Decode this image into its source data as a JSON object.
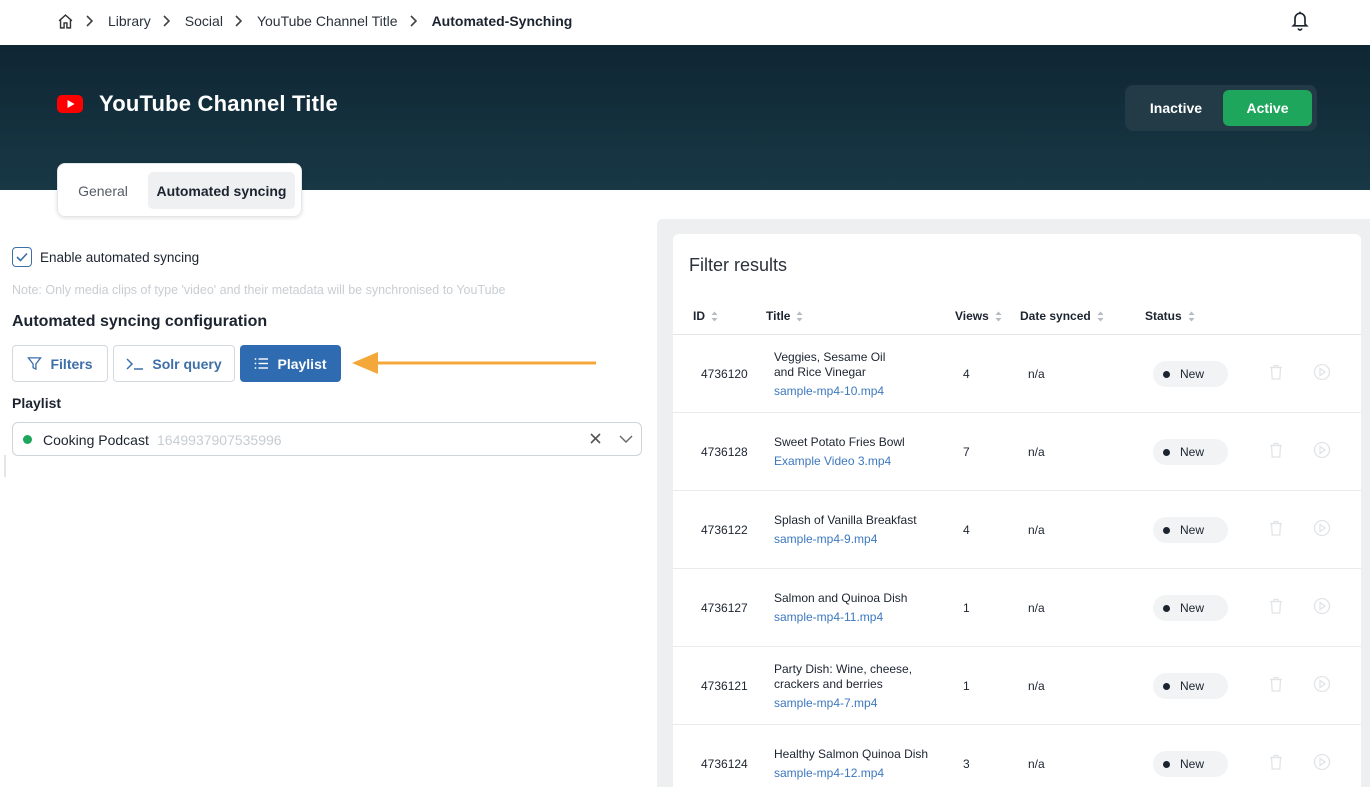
{
  "breadcrumb": {
    "items": [
      "Library",
      "Social",
      "YouTube Channel Title"
    ],
    "current": "Automated-Synching"
  },
  "header": {
    "title": "YouTube Channel Title",
    "status_toggle": {
      "inactive_label": "Inactive",
      "active_label": "Active",
      "selected": "Active"
    }
  },
  "tabs": [
    {
      "label": "General"
    },
    {
      "label": "Automated syncing",
      "selected": true
    }
  ],
  "config": {
    "enable_label": "Enable automated syncing",
    "enabled": true,
    "note": "Note: Only media clips of type 'video' and their metadata will be synchronised to YouTube",
    "section_title": "Automated syncing configuration",
    "buttons": {
      "filters": "Filters",
      "solr": "Solr query",
      "playlist": "Playlist"
    },
    "playlist_label": "Playlist",
    "playlist_name": "Cooking Podcast",
    "playlist_id": "1649937907535996"
  },
  "results": {
    "title": "Filter results",
    "columns": {
      "id": "ID",
      "title": "Title",
      "views": "Views",
      "date": "Date synced",
      "status": "Status"
    },
    "rows": [
      {
        "id": "4736120",
        "title_lines": [
          "Veggies, Sesame Oil",
          "and Rice Vinegar"
        ],
        "file": "sample-mp4-10.mp4",
        "views": "4",
        "date": "n/a",
        "status": "New"
      },
      {
        "id": "4736128",
        "title_lines": [
          "Sweet Potato Fries Bowl"
        ],
        "file": "Example Video 3.mp4",
        "views": "7",
        "date": "n/a",
        "status": "New"
      },
      {
        "id": "4736122",
        "title_lines": [
          "Splash of Vanilla Breakfast"
        ],
        "file": "sample-mp4-9.mp4",
        "views": "4",
        "date": "n/a",
        "status": "New"
      },
      {
        "id": "4736127",
        "title_lines": [
          "Salmon and Quinoa Dish"
        ],
        "file": "sample-mp4-11.mp4",
        "views": "1",
        "date": "n/a",
        "status": "New"
      },
      {
        "id": "4736121",
        "title_lines": [
          "Party Dish: Wine, cheese,",
          "crackers and berries"
        ],
        "file": "sample-mp4-7.mp4",
        "views": "1",
        "date": "n/a",
        "status": "New"
      },
      {
        "id": "4736124",
        "title_lines": [
          "Healthy Salmon Quinoa Dish"
        ],
        "file": "sample-mp4-12.mp4",
        "views": "3",
        "date": "n/a",
        "status": "New"
      }
    ]
  },
  "colors": {
    "active": "#1fa65d",
    "primary": "#2f6bb0",
    "arrow": "#f5a83a",
    "hero": "#0f2633"
  }
}
